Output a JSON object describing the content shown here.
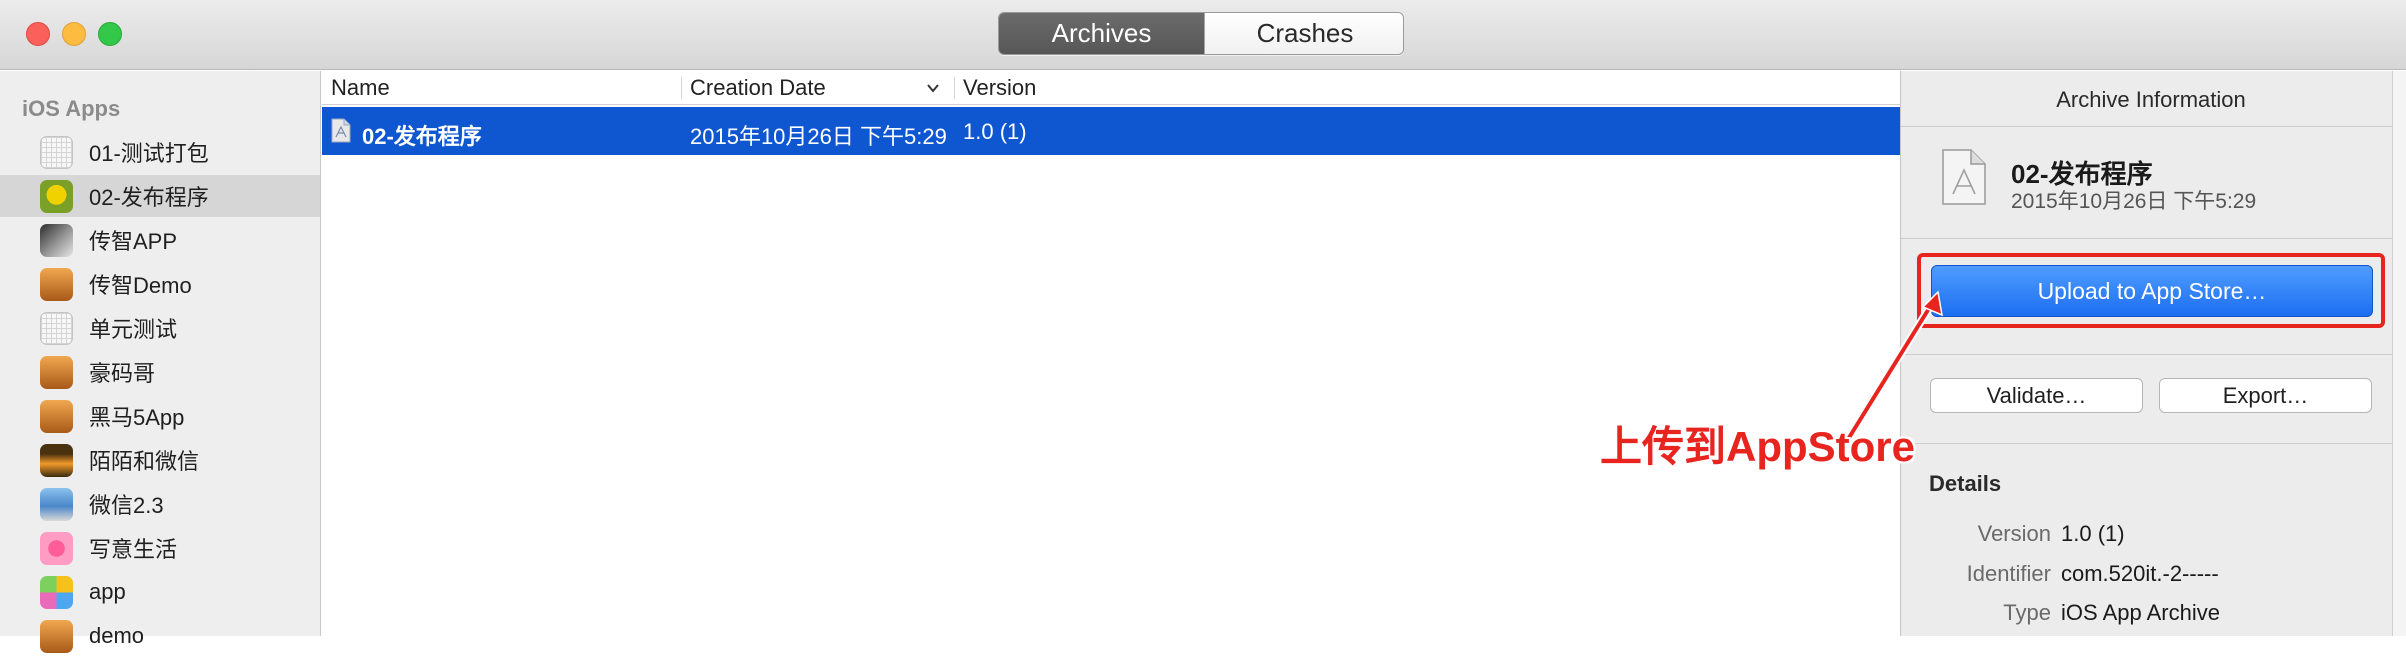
{
  "segmented": {
    "archives_label": "Archives",
    "crashes_label": "Crashes",
    "selected": "Archives"
  },
  "sidebar": {
    "heading": "iOS Apps",
    "items": [
      {
        "label": "01-测试打包",
        "icon": "blank-app-icon"
      },
      {
        "label": "02-发布程序",
        "icon": "gold-app-icon",
        "selected": true
      },
      {
        "label": "传智APP",
        "icon": "bw-app-icon"
      },
      {
        "label": "传智Demo",
        "icon": "wood-app-icon"
      },
      {
        "label": "单元测试",
        "icon": "blank-app-icon"
      },
      {
        "label": "豪码哥",
        "icon": "wood-app-icon"
      },
      {
        "label": "黑马5App",
        "icon": "wood-app-icon"
      },
      {
        "label": "陌陌和微信",
        "icon": "sunset-app-icon"
      },
      {
        "label": "微信2.3",
        "icon": "sea-app-icon"
      },
      {
        "label": "写意生活",
        "icon": "pink-app-icon"
      },
      {
        "label": "app",
        "icon": "multi-app-icon"
      },
      {
        "label": "demo",
        "icon": "wood-app-icon"
      }
    ]
  },
  "table": {
    "columns": [
      "Name",
      "Creation Date",
      "Version"
    ],
    "rows": [
      {
        "name": "02-发布程序",
        "date": "2015年10月26日 下午5:29",
        "version": "1.0 (1)",
        "selected": true
      }
    ]
  },
  "inspector": {
    "title": "Archive Information",
    "archive_name": "02-发布程序",
    "archive_date": "2015年10月26日 下午5:29",
    "upload_label": "Upload to App Store…",
    "validate_label": "Validate…",
    "export_label": "Export…",
    "details_heading": "Details",
    "details": [
      {
        "label": "Version",
        "value": "1.0 (1)"
      },
      {
        "label": "Identifier",
        "value": "com.520it.-2-----"
      },
      {
        "label": "Type",
        "value": "iOS App Archive"
      }
    ]
  },
  "annotation": {
    "text": "上传到AppStore",
    "color": "#e8241f"
  },
  "colors": {
    "selection": "#0f57d0",
    "primary_button": "#1c6ef0",
    "highlight": "#e8241f"
  }
}
